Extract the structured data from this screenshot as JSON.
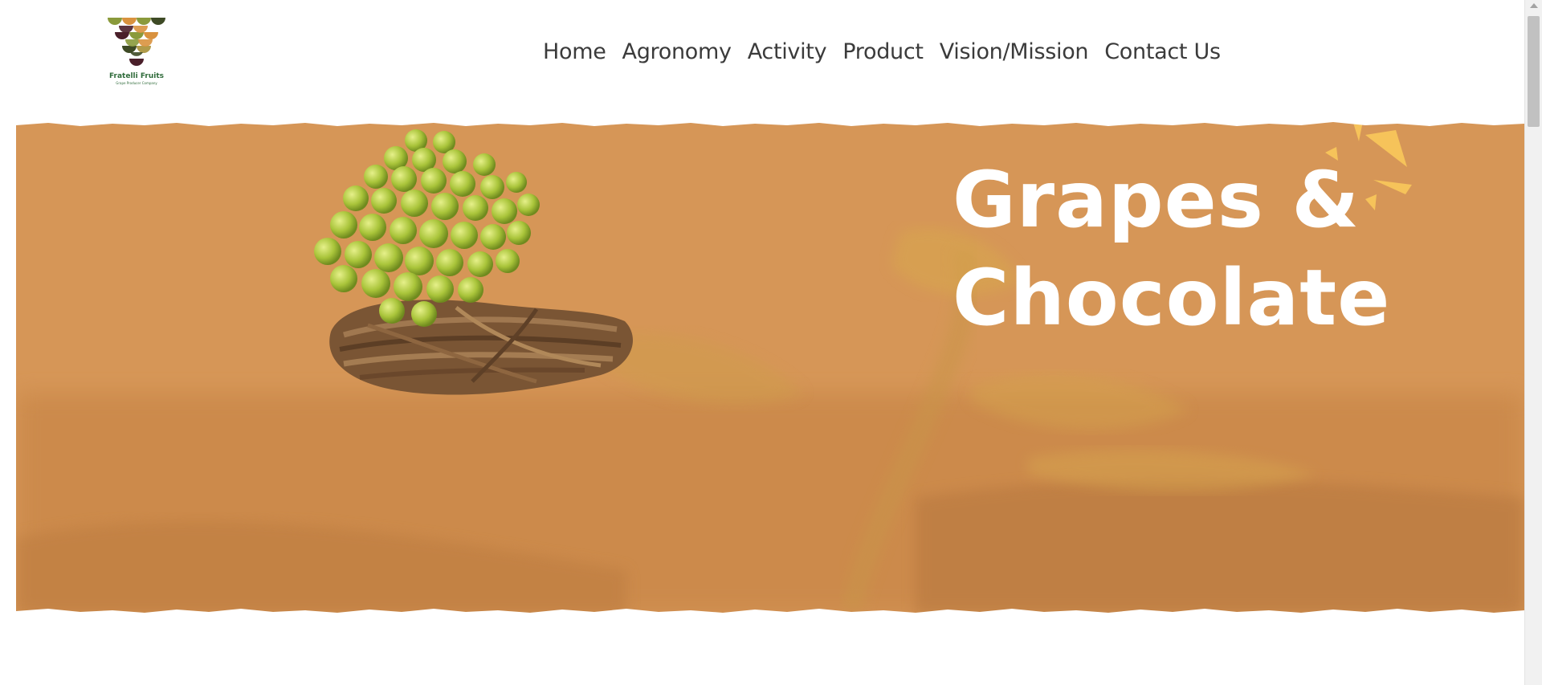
{
  "brand": {
    "name": "Fratelli Fruits",
    "tagline": "Grape Producer Company"
  },
  "nav": {
    "items": [
      "Home",
      "Agronomy",
      "Activity",
      "Product",
      "Vision/Mission",
      "Contact Us"
    ]
  },
  "hero": {
    "title_line1": "Grapes &",
    "title_line2": "Chocolate",
    "background_color": "#d69657",
    "accent_color": "#f6c35a"
  },
  "icons": {
    "logo": "grape-cluster-logo",
    "sparkle": "sparkle-burst-icon",
    "hero_image": "grape-basket-image"
  }
}
